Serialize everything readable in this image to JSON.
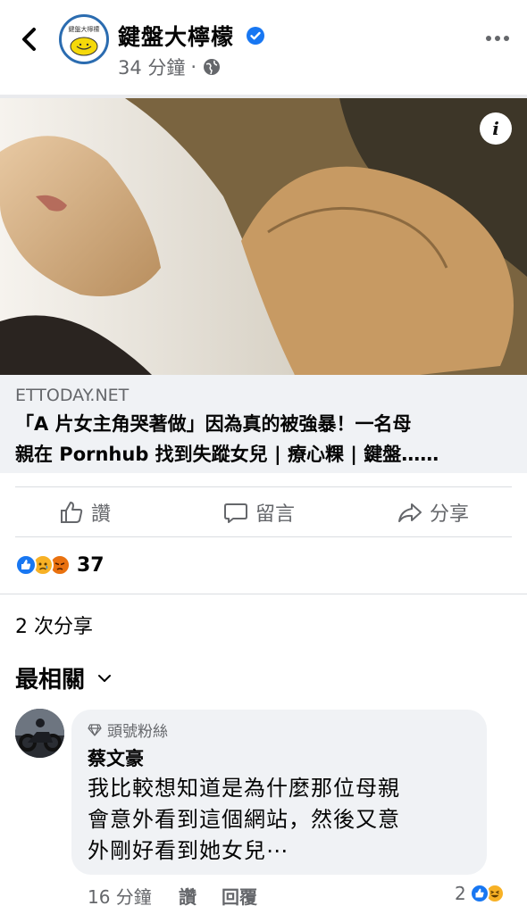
{
  "header": {
    "page_name": "鍵盤大檸檬",
    "time": "34 分鐘",
    "separator": "·",
    "logo_text": "鍵盤大檸檬",
    "icons": [
      "back-icon",
      "verified-icon",
      "globe-icon",
      "more-icon"
    ]
  },
  "link": {
    "domain": "ETTODAY.NET",
    "title_line1": "「A 片女主角哭著做」因為真的被強暴！一名母",
    "title_line2": "親在 Pornhub 找到失蹤女兒 | 療心粿 | 鍵盤……",
    "info_label": "i"
  },
  "actions": {
    "like": "讚",
    "comment": "留言",
    "share": "分享"
  },
  "reactions": {
    "count": "37",
    "types": [
      "like",
      "sad",
      "angry"
    ],
    "colors": {
      "like": "#1877f2",
      "sad": "#f7b125",
      "angry": "#e9710f"
    }
  },
  "shares": "2 次分享",
  "sort": {
    "label": "最相關"
  },
  "comment": {
    "badge": "頭號粉絲",
    "author": "蔡文豪",
    "line1": "我比較想知道是為什麼那位母親",
    "line2": "會意外看到這個網站，然後又意",
    "line3": "外剛好看到她女兒⋯",
    "time": "16 分鐘",
    "like": "讚",
    "reply": "回覆",
    "reaction_count": "2"
  }
}
